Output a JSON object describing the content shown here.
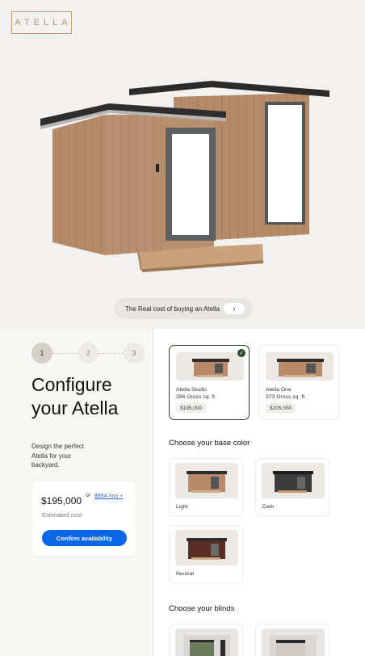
{
  "brand": {
    "logo": "ATELLA"
  },
  "hero": {
    "cost_link": "The Real cost of buying an Atella",
    "cost_chevron": "›"
  },
  "stepper": {
    "steps": [
      "1",
      "2",
      "3"
    ],
    "active": 1
  },
  "configure": {
    "title": "Configure your Atella",
    "subtitle": "Design the perfect Atella for your backyard."
  },
  "price_card": {
    "price": "$195,000",
    "or": "or",
    "monthly": "$954 /mo +",
    "estimated": "Estimated cost",
    "confirm": "Confirm availability"
  },
  "models": [
    {
      "name": "Atella Studio",
      "size": "266 Gross sq. ft.",
      "price": "$195,000",
      "selected": true
    },
    {
      "name": "Atella One",
      "size": "373 Gross sq. ft.",
      "price": "$205,000",
      "selected": false
    }
  ],
  "base_color": {
    "heading": "Choose your base color",
    "options": [
      {
        "label": "Light",
        "swatch": "#b98a6a"
      },
      {
        "label": "Dark",
        "swatch": "#3b3b3b"
      },
      {
        "label": "Neutral",
        "swatch": "#5a2e24"
      }
    ]
  },
  "blinds": {
    "heading": "Choose your blinds"
  },
  "colors": {
    "accent": "#0a66e6",
    "brand": "#b8906e",
    "selected_check": "#2f4a2f"
  }
}
